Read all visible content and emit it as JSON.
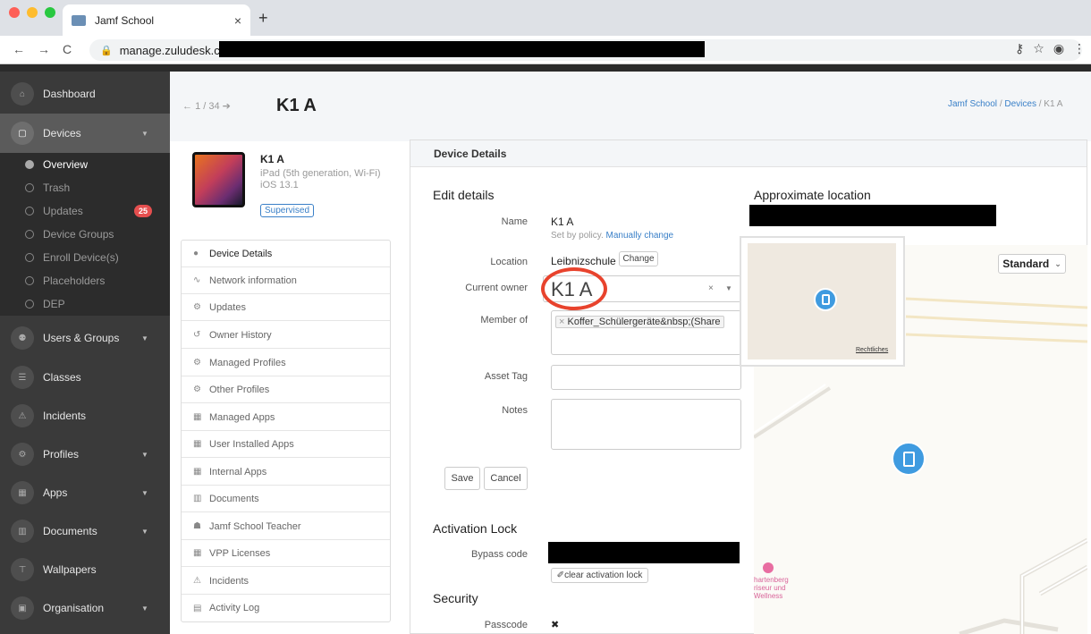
{
  "browser": {
    "tab_title": "Jamf School",
    "tab_close": "×",
    "new_tab": "+",
    "url": "manage.zuludesk.com/",
    "nav_back": "←",
    "nav_forward": "→",
    "nav_reload": "C",
    "icons": [
      "key-icon",
      "star-icon",
      "account-icon",
      "menu-icon"
    ]
  },
  "sidebar": {
    "items": [
      {
        "label": "Dashboard",
        "icon": "home-icon"
      },
      {
        "label": "Devices",
        "icon": "device-icon",
        "expanded": true
      },
      {
        "label": "Users & Groups",
        "icon": "users-icon"
      },
      {
        "label": "Classes",
        "icon": "classes-icon"
      },
      {
        "label": "Incidents",
        "icon": "incidents-icon"
      },
      {
        "label": "Profiles",
        "icon": "profiles-icon"
      },
      {
        "label": "Apps",
        "icon": "apps-icon"
      },
      {
        "label": "Documents",
        "icon": "documents-icon"
      },
      {
        "label": "Wallpapers",
        "icon": "wallpapers-icon"
      },
      {
        "label": "Organisation",
        "icon": "organisation-icon"
      }
    ],
    "devices_sub": [
      "Overview",
      "Trash",
      "Updates",
      "Device Groups",
      "Enroll Device(s)",
      "Placeholders",
      "DEP"
    ],
    "updates_badge": "25"
  },
  "header": {
    "pager": "1 / 34",
    "title": "K1 A",
    "breadcrumb": [
      "Jamf School",
      "Devices",
      "K1 A"
    ],
    "sep": "/"
  },
  "device": {
    "name": "K1 A",
    "model": "iPad (5th generation, Wi-Fi)",
    "os": "iOS 13.1",
    "badge": "Supervised"
  },
  "menu": [
    {
      "label": "Device Details",
      "icon": "apple-icon",
      "active": true
    },
    {
      "label": "Network information",
      "icon": "network-icon"
    },
    {
      "label": "Updates",
      "icon": "updates-icon"
    },
    {
      "label": "Owner History",
      "icon": "history-icon"
    },
    {
      "label": "Managed Profiles",
      "icon": "profiles-icon"
    },
    {
      "label": "Other Profiles",
      "icon": "profiles-icon"
    },
    {
      "label": "Managed Apps",
      "icon": "apps-icon"
    },
    {
      "label": "User Installed Apps",
      "icon": "apps-icon"
    },
    {
      "label": "Internal Apps",
      "icon": "apps-icon"
    },
    {
      "label": "Documents",
      "icon": "documents-icon"
    },
    {
      "label": "Jamf School Teacher",
      "icon": "teacher-icon"
    },
    {
      "label": "VPP Licenses",
      "icon": "apps-icon"
    },
    {
      "label": "Incidents",
      "icon": "incidents-icon"
    },
    {
      "label": "Activity Log",
      "icon": "log-icon"
    }
  ],
  "details": {
    "panel_title": "Device Details",
    "edit_title": "Edit details",
    "name_label": "Name",
    "name_value": "K1 A",
    "policy_note": "Set by policy.",
    "policy_link": "Manually change",
    "location_label": "Location",
    "location_value": "Leibnizschule",
    "change_btn": "Change",
    "owner_label": "Current owner",
    "owner_value": "K1 A",
    "member_label": "Member of",
    "member_tag": "Koffer_Schülergeräte&nbsp;(Share",
    "asset_label": "Asset Tag",
    "notes_label": "Notes",
    "save": "Save",
    "cancel": "Cancel",
    "activation_title": "Activation Lock",
    "bypass_label": "Bypass code",
    "clear_btn": "clear activation lock",
    "security_title": "Security",
    "passcode_label": "Passcode",
    "passcode_value": "✖"
  },
  "map": {
    "title": "Approximate location",
    "map_type": "Standard",
    "legal": "Rechtliches",
    "poi": [
      "hartenberg",
      "riseur und",
      "Wellness"
    ]
  },
  "colors": {
    "accent": "#3a80c8",
    "badge": "#e54f4f",
    "pin": "#3f9be0",
    "highlight": "#e8432d"
  }
}
